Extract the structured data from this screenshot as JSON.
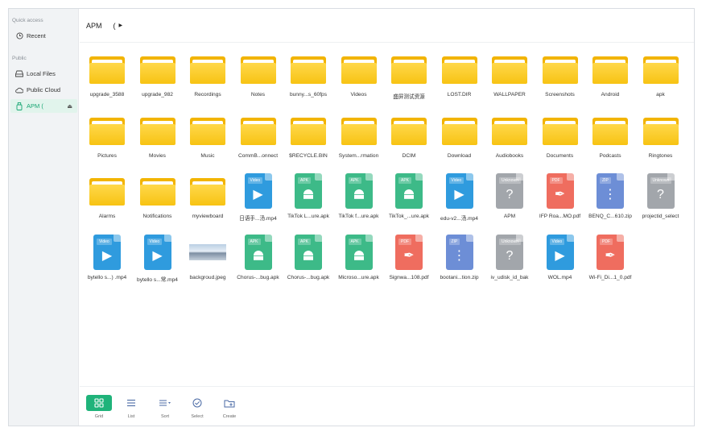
{
  "sidebar": {
    "quick_access_label": "Quick access",
    "recent_label": "Recent",
    "public_label": "Public",
    "items": [
      {
        "label": "Local Files"
      },
      {
        "label": "Public Cloud"
      },
      {
        "label": "APM   ("
      }
    ]
  },
  "header": {
    "crumb": "APM",
    "sep": "(",
    "arrow": "▶"
  },
  "files": [
    {
      "name": "upgrade_3588",
      "kind": "folder"
    },
    {
      "name": "upgrade_982",
      "kind": "folder"
    },
    {
      "name": "Recordings",
      "kind": "folder"
    },
    {
      "name": "Notes",
      "kind": "folder"
    },
    {
      "name": "bunny...s_60fps",
      "kind": "folder"
    },
    {
      "name": "Videos",
      "kind": "folder"
    },
    {
      "name": "盛屏测试资源",
      "kind": "folder"
    },
    {
      "name": "LOST.DIR",
      "kind": "folder"
    },
    {
      "name": "WALLPAPER",
      "kind": "folder"
    },
    {
      "name": "Screenshots",
      "kind": "folder"
    },
    {
      "name": "Android",
      "kind": "folder"
    },
    {
      "name": "apk",
      "kind": "folder"
    },
    {
      "name": "Pictures",
      "kind": "folder"
    },
    {
      "name": "Movies",
      "kind": "folder"
    },
    {
      "name": "Music",
      "kind": "folder"
    },
    {
      "name": "CommB...onnect",
      "kind": "folder"
    },
    {
      "name": "$RECYCLE.BIN",
      "kind": "folder"
    },
    {
      "name": "System...rmation",
      "kind": "folder"
    },
    {
      "name": "DCIM",
      "kind": "folder"
    },
    {
      "name": "Download",
      "kind": "folder"
    },
    {
      "name": "Audiobooks",
      "kind": "folder"
    },
    {
      "name": "Documents",
      "kind": "folder"
    },
    {
      "name": "Podcasts",
      "kind": "folder"
    },
    {
      "name": "Ringtones",
      "kind": "folder"
    },
    {
      "name": "Alarms",
      "kind": "folder"
    },
    {
      "name": "Notifications",
      "kind": "folder"
    },
    {
      "name": "myviewboard",
      "kind": "folder"
    },
    {
      "name": "日语手...汤.mp4",
      "kind": "video",
      "tag": "Video"
    },
    {
      "name": "TikTok L...ure.apk",
      "kind": "apk",
      "tag": "APK"
    },
    {
      "name": "TikTok f...ure.apk",
      "kind": "apk",
      "tag": "APK"
    },
    {
      "name": "TikTok_...ure.apk",
      "kind": "apk",
      "tag": "APK"
    },
    {
      "name": "edu-v2...汤.mp4",
      "kind": "video",
      "tag": "Video"
    },
    {
      "name": "APM",
      "kind": "unknown",
      "tag": "Unknown"
    },
    {
      "name": "IFP Roa...MO.pdf",
      "kind": "pdf",
      "tag": "PDF"
    },
    {
      "name": "BENQ_C...610.zip",
      "kind": "zip",
      "tag": "ZIP"
    },
    {
      "name": "projectid_select",
      "kind": "unknown",
      "tag": "Unknown"
    },
    {
      "name": "bytello s...) .mp4",
      "kind": "video",
      "tag": "Video"
    },
    {
      "name": "bytello s...常.mp4",
      "kind": "video",
      "tag": "Video"
    },
    {
      "name": "backgroud.jpeg",
      "kind": "image"
    },
    {
      "name": "Chorus-...bug.apk",
      "kind": "apk",
      "tag": "APK"
    },
    {
      "name": "Chorus-...bug.apk",
      "kind": "apk",
      "tag": "APK"
    },
    {
      "name": "Microso...ure.apk",
      "kind": "apk",
      "tag": "APK"
    },
    {
      "name": "Signwa...108.pdf",
      "kind": "pdf",
      "tag": "PDF"
    },
    {
      "name": "bootani...tion.zip",
      "kind": "zip",
      "tag": "ZIP"
    },
    {
      "name": "iv_udisk_id_bak",
      "kind": "unknown",
      "tag": "Unknown"
    },
    {
      "name": "WOL.mp4",
      "kind": "video",
      "tag": "Video"
    },
    {
      "name": "Wi-Fi_Di...1_0.pdf",
      "kind": "pdf",
      "tag": "PDF"
    }
  ],
  "toolbar": {
    "grid_label": "Grid",
    "list_label": "List",
    "sort_label": "Sort",
    "select_label": "Select",
    "create_label": "Create"
  },
  "colors": {
    "accent": "#1fb37a",
    "folder": "#f7c313",
    "video": "#2f9bde",
    "apk": "#3dba88",
    "unknown": "#a2a6ab",
    "pdf": "#ef6d5f",
    "zip": "#6d8ed6"
  }
}
